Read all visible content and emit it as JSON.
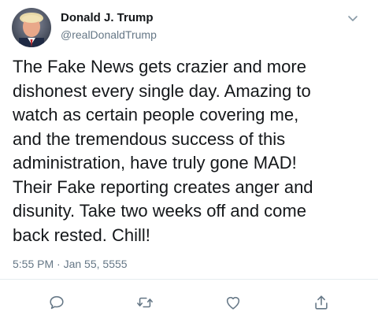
{
  "user": {
    "display_name": "Donald J. Trump",
    "handle": "@realDonaldTrump",
    "avatar_icon": "profile-photo"
  },
  "tweet": {
    "text": "The Fake News gets crazier and more\ndishonest every single day. Amazing to\nwatch as certain people covering me,\nand the tremendous success of this\nadministration, have truly gone MAD!\nTheir Fake reporting creates anger and\ndisunity. Take two weeks off and come\nback rested. Chill!",
    "time": "5:55 PM",
    "separator": "·",
    "date": "Jan 55, 5555"
  },
  "icons": {
    "menu": "chevron-down-icon",
    "reply": "reply-icon",
    "retweet": "retweet-icon",
    "like": "heart-icon",
    "share": "share-icon"
  },
  "colors": {
    "text": "#14171a",
    "secondary": "#657786",
    "divider": "#e6ecf0"
  }
}
